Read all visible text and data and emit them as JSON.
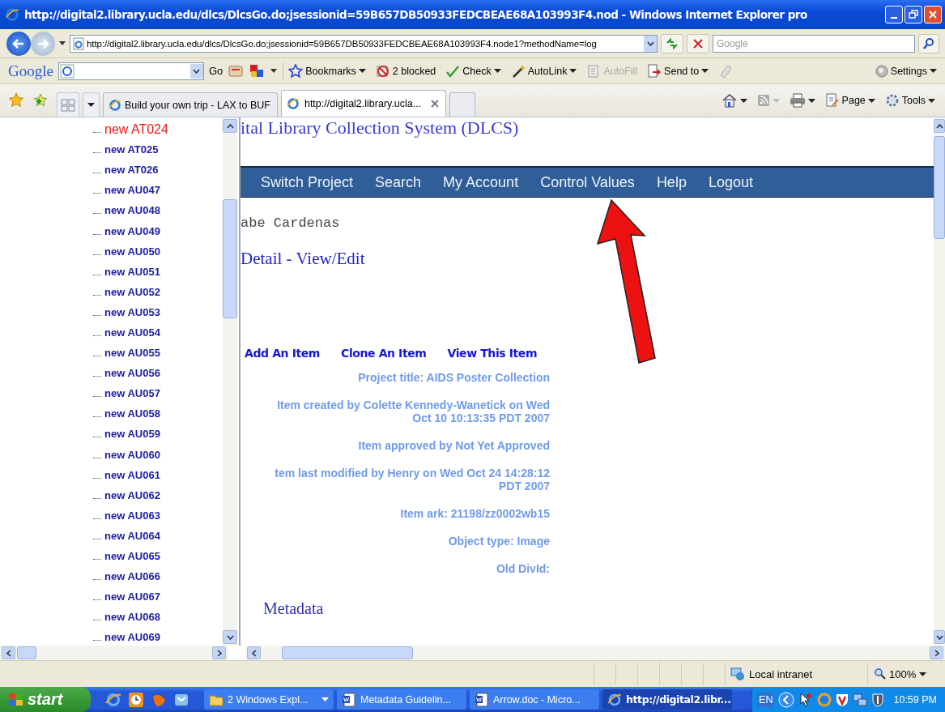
{
  "window": {
    "title": "http://digital2.library.ucla.edu/dlcs/DlcsGo.do;jsessionid=59B657DB50933FEDCBEAE68A103993F4.nod - Windows Internet Explorer pro"
  },
  "address_bar": {
    "value": "http://digital2.library.ucla.edu/dlcs/DlcsGo.do;jsessionid=59B657DB50933FEDCBEAE68A103993F4.node1?methodName=log"
  },
  "search": {
    "placeholder": "Google"
  },
  "google_toolbar": {
    "logo": "Google",
    "go": "Go",
    "settings": "Settings",
    "items": [
      {
        "label": "Bookmarks",
        "kind": "bookmarks",
        "disabled": false
      },
      {
        "label": "2 blocked",
        "kind": "blocked",
        "disabled": false
      },
      {
        "label": "Check",
        "kind": "check",
        "disabled": false
      },
      {
        "label": "AutoLink",
        "kind": "autolink",
        "disabled": false
      },
      {
        "label": "AutoFill",
        "kind": "autofill",
        "disabled": true
      },
      {
        "label": "Send to",
        "kind": "sendto",
        "disabled": false
      }
    ]
  },
  "tabs": [
    {
      "label": "Build your own trip - LAX to BUF",
      "selected": false
    },
    {
      "label": "http://digital2.library.ucla...",
      "selected": true
    }
  ],
  "command_bar": [
    {
      "label": "Page",
      "kind": "page"
    },
    {
      "label": "Tools",
      "kind": "tools"
    }
  ],
  "tree": {
    "items": [
      {
        "label": "new AT024",
        "selected": true
      },
      {
        "label": "new AT025",
        "selected": false
      },
      {
        "label": "new AT026",
        "selected": false
      },
      {
        "label": "new AU047",
        "selected": false
      },
      {
        "label": "new AU048",
        "selected": false
      },
      {
        "label": "new AU049",
        "selected": false
      },
      {
        "label": "new AU050",
        "selected": false
      },
      {
        "label": "new AU051",
        "selected": false
      },
      {
        "label": "new AU052",
        "selected": false
      },
      {
        "label": "new AU053",
        "selected": false
      },
      {
        "label": "new AU054",
        "selected": false
      },
      {
        "label": "new AU055",
        "selected": false
      },
      {
        "label": "new AU056",
        "selected": false
      },
      {
        "label": "new AU057",
        "selected": false
      },
      {
        "label": "new AU058",
        "selected": false
      },
      {
        "label": "new AU059",
        "selected": false
      },
      {
        "label": "new AU060",
        "selected": false
      },
      {
        "label": "new AU061",
        "selected": false
      },
      {
        "label": "new AU062",
        "selected": false
      },
      {
        "label": "new AU063",
        "selected": false
      },
      {
        "label": "new AU064",
        "selected": false
      },
      {
        "label": "new AU065",
        "selected": false
      },
      {
        "label": "new AU066",
        "selected": false
      },
      {
        "label": "new AU067",
        "selected": false
      },
      {
        "label": "new AU068",
        "selected": false
      },
      {
        "label": "new AU069",
        "selected": false
      }
    ]
  },
  "page": {
    "site_title": "ital Library Collection System (DLCS)",
    "nav": [
      "Switch Project",
      "Search",
      "My Account",
      "Control Values",
      "Help",
      "Logout"
    ],
    "user": "abe Cardenas",
    "heading": "Detail - View/Edit",
    "actions": [
      "Add An Item",
      "Clone An Item",
      "View This Item"
    ],
    "info": [
      {
        "lines": [
          "Project title: AIDS Poster Collection"
        ]
      },
      {
        "lines": [
          "Item created by Colette Kennedy-Wanetick on Wed",
          "Oct 10 10:13:35 PDT 2007"
        ]
      },
      {
        "lines": [
          "Item approved by Not Yet Approved"
        ]
      },
      {
        "lines": [
          "tem last modified by Henry on Wed Oct 24 14:28:12",
          "PDT 2007"
        ]
      },
      {
        "lines": [
          "Item ark: 21198/zz0002wb15"
        ]
      },
      {
        "lines": [
          "Object type: Image"
        ]
      },
      {
        "lines": [
          "Old DivId:"
        ]
      }
    ],
    "section": "Metadata"
  },
  "status_bar": {
    "zone": "Local intranet",
    "zoom": "100%"
  },
  "taskbar": {
    "start": "start",
    "tasks": [
      {
        "label": "2 Windows Expl...",
        "kind": "folder",
        "selected": false
      },
      {
        "label": "Metadata Guidelin...",
        "kind": "word",
        "selected": false
      },
      {
        "label": "Arrow.doc - Micro...",
        "kind": "word",
        "selected": false
      },
      {
        "label": "http://digital2.libr...",
        "kind": "ie",
        "selected": true
      }
    ],
    "language": "EN",
    "clock": "10:59 PM"
  }
}
